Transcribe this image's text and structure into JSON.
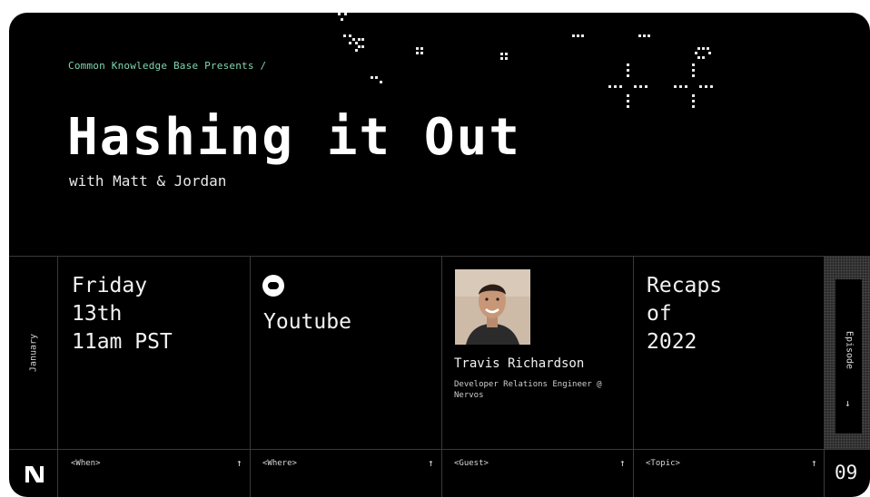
{
  "header": {
    "presents": "Common Knowledge Base Presents /",
    "title": "Hashing it Out",
    "subtitle": "with Matt & Jordan"
  },
  "schedule": {
    "month": "January",
    "when_line1": "Friday",
    "when_line2": "13th",
    "when_line3": "11am PST",
    "where": "Youtube",
    "guest_name": "Travis Richardson",
    "guest_role": "Developer Relations Engineer @ Nervos",
    "topic_line1": "Recaps",
    "topic_line2": "of",
    "topic_line3": "2022"
  },
  "labels": {
    "when": "<When>",
    "where": "<Where>",
    "guest": "<Guest>",
    "topic": "<Topic>",
    "arrow_up": "↑",
    "arrow_down": "↓"
  },
  "episode": {
    "label": "Episode",
    "number": "09"
  },
  "icons": [
    "youtube-icon",
    "guest-photo",
    "logo-n-icon",
    "pixel-hash-decoration"
  ],
  "colors": {
    "background": "#000000",
    "accent_text": "#7fd6b0",
    "grid_line": "#3a3a3a"
  }
}
